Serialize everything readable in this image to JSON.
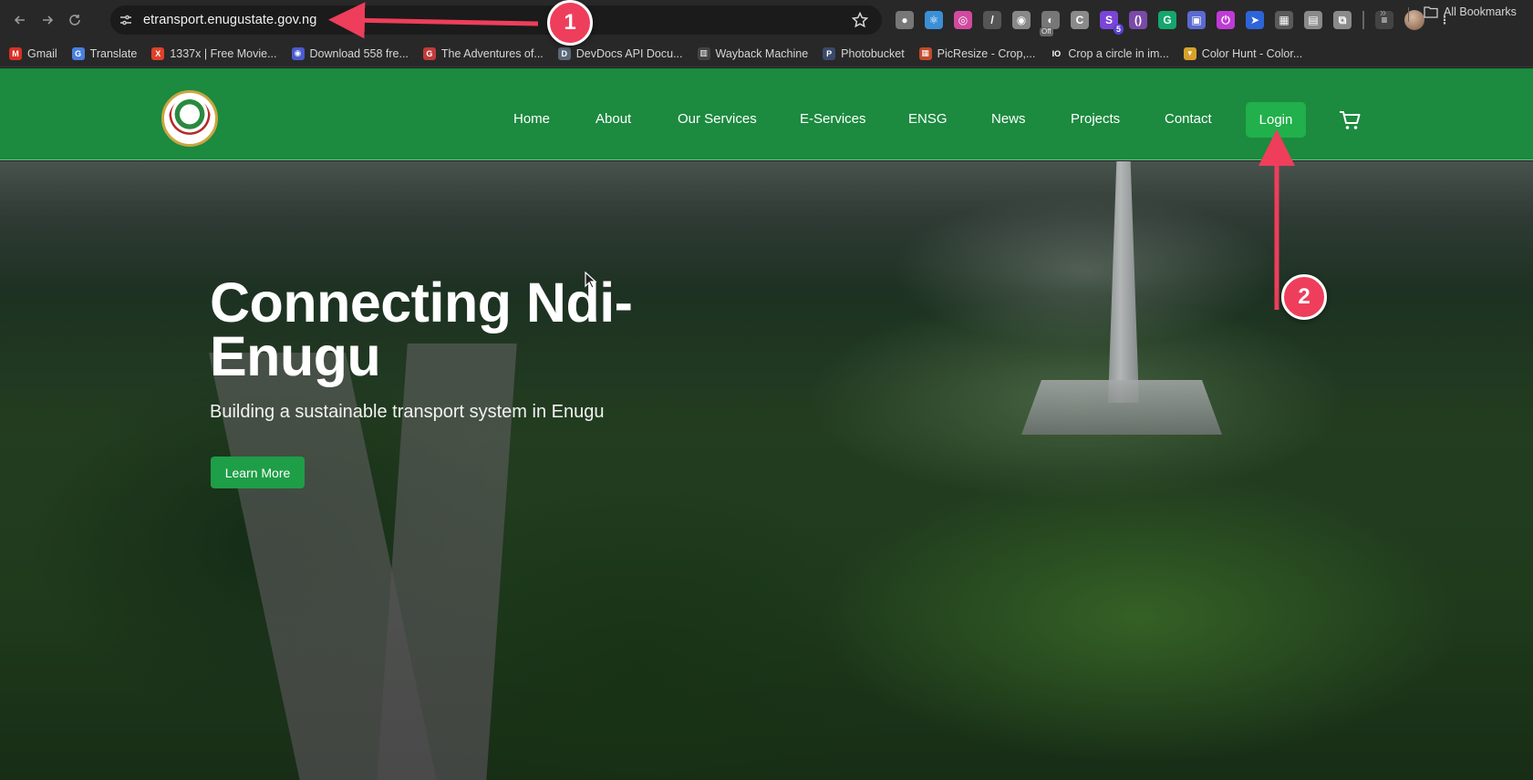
{
  "browser": {
    "url": "etransport.enugustate.gov.ng",
    "extensions": [
      {
        "name": "dropper-icon",
        "color": "#777777",
        "glyph": "●"
      },
      {
        "name": "react-devtools-icon",
        "color": "#3a8fd6",
        "glyph": "⚛"
      },
      {
        "name": "color-picker-icon",
        "color": "#d14aa0",
        "glyph": "◎"
      },
      {
        "name": "pen-icon",
        "color": "#555555",
        "glyph": "/"
      },
      {
        "name": "target-icon",
        "color": "#888888",
        "glyph": "◉"
      },
      {
        "name": "off-extension-icon",
        "color": "#777777",
        "glyph": "◐",
        "label": "Off"
      },
      {
        "name": "c-extension-icon",
        "color": "#8a8a8a",
        "glyph": "C"
      },
      {
        "name": "s-extension-icon",
        "color": "#7a45d8",
        "glyph": "S",
        "badge": "5"
      },
      {
        "name": "brackets-extension-icon",
        "color": "#7a4aa8",
        "glyph": "()"
      },
      {
        "name": "grammarly-icon",
        "color": "#15a66e",
        "glyph": "G"
      },
      {
        "name": "screen-capture-icon",
        "color": "#5a6ad0",
        "glyph": "▣"
      },
      {
        "name": "power-extension-icon",
        "color": "#c03bd6",
        "glyph": "⏻"
      },
      {
        "name": "cursor-extension-icon",
        "color": "#2d64d8",
        "glyph": "➤"
      },
      {
        "name": "grid-extension-icon",
        "color": "#5a5a5a",
        "glyph": "▦"
      },
      {
        "name": "reader-extension-icon",
        "color": "#8a8a8a",
        "glyph": "▤"
      },
      {
        "name": "puzzle-icon",
        "color": "#8a8a8a",
        "glyph": "⧉"
      }
    ],
    "bookmarks": [
      {
        "label": "Gmail",
        "color": "#d93025",
        "glyph": "M"
      },
      {
        "label": "Translate",
        "color": "#4a7fe0",
        "glyph": "G"
      },
      {
        "label": "1337x | Free Movie...",
        "color": "#e0402a",
        "glyph": "X"
      },
      {
        "label": "Download 558 fre...",
        "color": "#4a5bd0",
        "glyph": "◉"
      },
      {
        "label": "The Adventures of...",
        "color": "#c23a3a",
        "glyph": "G"
      },
      {
        "label": "DevDocs API Docu...",
        "color": "#5a6a78",
        "glyph": "D"
      },
      {
        "label": "Wayback Machine",
        "color": "#444444",
        "glyph": "▥"
      },
      {
        "label": "Photobucket",
        "color": "#3a4a6a",
        "glyph": "P"
      },
      {
        "label": "PicResize - Crop,...",
        "color": "#c24a2a",
        "glyph": "▦"
      },
      {
        "label": "Crop a circle in im...",
        "color": "#282828",
        "glyph": "IO"
      },
      {
        "label": "Color Hunt - Color...",
        "color": "#d8a22a",
        "glyph": "▾"
      }
    ],
    "all_bookmarks": "All Bookmarks"
  },
  "site": {
    "nav": [
      "Home",
      "About",
      "Our Services",
      "E-Services",
      "ENSG",
      "News",
      "Projects",
      "Contact"
    ],
    "login": "Login",
    "hero": {
      "title": "Connecting Ndi-Enugu",
      "subtitle": "Building a sustainable transport system in Enugu",
      "button": "Learn More"
    },
    "brand_color": "#1c8a3f",
    "button_color": "#21b04b"
  },
  "annotations": {
    "marker1": "1",
    "marker2": "2",
    "color": "#ee3e5b"
  }
}
